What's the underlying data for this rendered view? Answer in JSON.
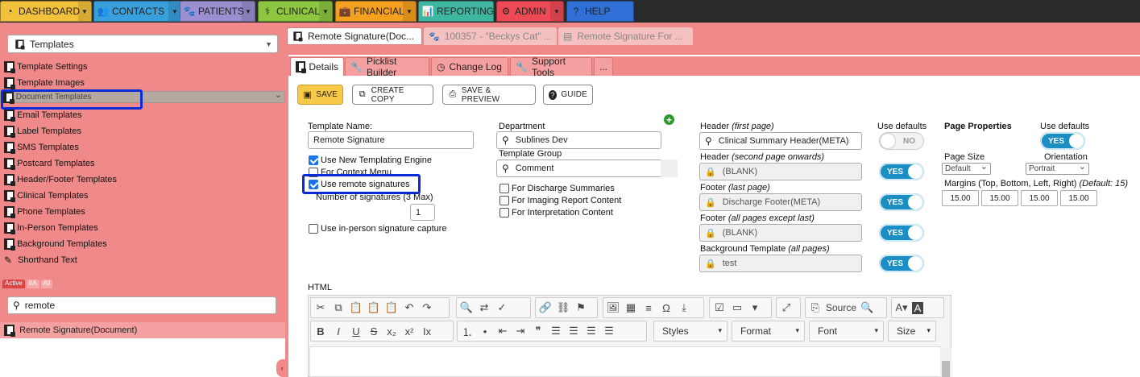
{
  "nav": [
    {
      "label": "DASHBOARD",
      "icon": "gauge-icon",
      "color": "#f2c13c"
    },
    {
      "label": "CONTACTS",
      "icon": "people-icon",
      "color": "#3aa0dc"
    },
    {
      "label": "PATIENTS",
      "icon": "paw-icon",
      "color": "#9b8fd0"
    },
    {
      "label": "CLINICAL",
      "icon": "caduceus-icon",
      "color": "#8dc63f"
    },
    {
      "label": "FINANCIAL",
      "icon": "briefcase-icon",
      "color": "#f5a020"
    },
    {
      "label": "REPORTING",
      "icon": "bar-chart-icon",
      "color": "#3fb7a0"
    },
    {
      "label": "ADMIN",
      "icon": "gear-icon",
      "color": "#ee4a56"
    },
    {
      "label": "HELP",
      "icon": "question-icon",
      "color": "#2f6fd6"
    }
  ],
  "sidebar": {
    "select_label": "Templates",
    "items": [
      {
        "label": "Template Settings"
      },
      {
        "label": "Template Images"
      },
      {
        "label": "Document Templates"
      },
      {
        "label": "Email Templates"
      },
      {
        "label": "Label Templates"
      },
      {
        "label": "SMS Templates"
      },
      {
        "label": "Postcard Templates"
      },
      {
        "label": "Header/Footer Templates"
      },
      {
        "label": "Clinical Templates"
      },
      {
        "label": "Phone Templates"
      },
      {
        "label": "In-Person Templates"
      },
      {
        "label": "Background Templates"
      },
      {
        "label": "Shorthand Text"
      }
    ],
    "filter_tabs": [
      "Active",
      "I/A",
      "All"
    ],
    "search_value": "remote",
    "result": "Remote Signature(Document)"
  },
  "doctabs": [
    {
      "label": "Remote Signature(Doc..."
    },
    {
      "label": "100357 - \"Beckys Cat\" ..."
    },
    {
      "label": "Remote Signature For ..."
    }
  ],
  "subtabs": [
    {
      "label": "Details"
    },
    {
      "label": "Picklist Builder"
    },
    {
      "label": "Change Log"
    },
    {
      "label": "Support Tools"
    },
    {
      "label": "..."
    }
  ],
  "toolbar": {
    "save": "SAVE",
    "copy": "CREATE COPY",
    "preview": "SAVE & PREVIEW",
    "guide": "GUIDE"
  },
  "form": {
    "template_name_label": "Template Name:",
    "template_name": "Remote Signature",
    "new_engine": "Use New Templating Engine",
    "context_menu": "For Context Menu",
    "remote_sig": "Use remote signatures",
    "num_sig_label": "Number of signatures (3 Max)",
    "num_sig": "1",
    "in_person": "Use in-person signature capture",
    "department_label": "Department",
    "department": "Sublines Dev",
    "group_label": "Template Group",
    "group": "Comment",
    "discharge": "For Discharge Summaries",
    "imaging": "For Imaging Report Content",
    "interp": "For Interpretation Content",
    "html_label": "HTML"
  },
  "headers": {
    "use_defaults": "Use defaults",
    "rows": [
      {
        "label": "Header ",
        "hint": "(first page)",
        "value": "Clinical Summary Header(META)",
        "toggle": "NO"
      },
      {
        "label": "Header ",
        "hint": "(second page onwards)",
        "value": "(BLANK)",
        "toggle": "YES"
      },
      {
        "label": "Footer ",
        "hint": "(last page)",
        "value": "Discharge Footer(META)",
        "toggle": "YES"
      },
      {
        "label": "Footer ",
        "hint": "(all pages except last)",
        "value": "(BLANK)",
        "toggle": "YES"
      },
      {
        "label": "Background Template ",
        "hint": "(all pages)",
        "value": "test",
        "toggle": "YES"
      }
    ]
  },
  "page_props": {
    "title": "Page Properties",
    "use_defaults": "Use defaults",
    "toggle": "YES",
    "size_label": "Page Size",
    "size": "Default",
    "orient_label": "Orientation",
    "orient": "Portrait",
    "margins_label": "Margins (Top, Bottom, Left, Right) ",
    "margins_hint": "(Default: 15)",
    "margins": [
      "15.00",
      "15.00",
      "15.00",
      "15.00"
    ]
  },
  "editor": {
    "source": "Source",
    "styles": "Styles",
    "format": "Format",
    "font": "Font",
    "size": "Size"
  }
}
